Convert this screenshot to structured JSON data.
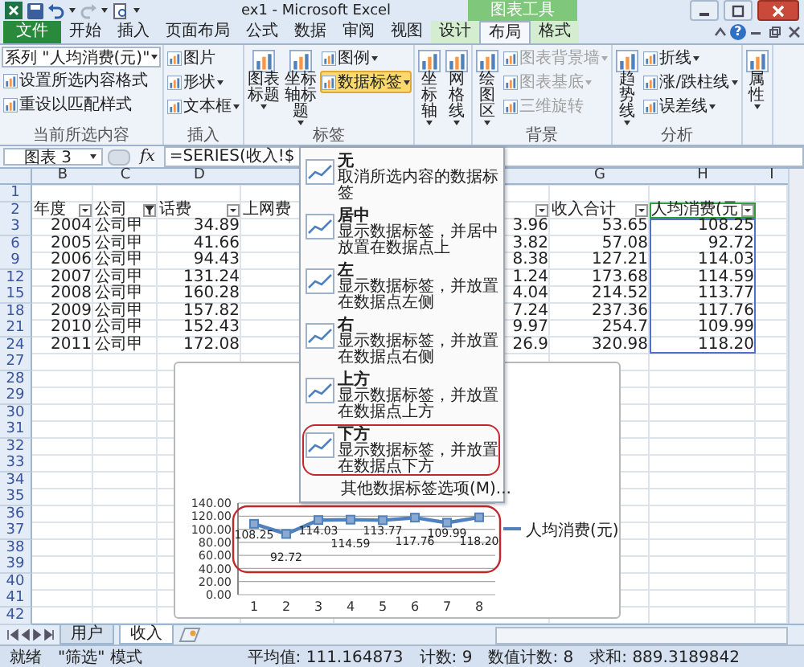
{
  "title_bar": {
    "title": "ex1 - Microsoft Excel",
    "context_label": "图表工具"
  },
  "tabs": [
    {
      "label": "文件",
      "kind": "file",
      "selected": false
    },
    {
      "label": "开始",
      "kind": "normal",
      "selected": false
    },
    {
      "label": "插入",
      "kind": "normal",
      "selected": false
    },
    {
      "label": "页面布局",
      "kind": "normal",
      "selected": false
    },
    {
      "label": "公式",
      "kind": "normal",
      "selected": false
    },
    {
      "label": "数据",
      "kind": "normal",
      "selected": false
    },
    {
      "label": "审阅",
      "kind": "normal",
      "selected": false
    },
    {
      "label": "视图",
      "kind": "normal",
      "selected": false
    },
    {
      "label": "设计",
      "kind": "context",
      "selected": false
    },
    {
      "label": "布局",
      "kind": "context",
      "selected": true
    },
    {
      "label": "格式",
      "kind": "context",
      "selected": false
    }
  ],
  "help": "?",
  "ribbon": {
    "groups": [
      {
        "label": "当前所选内容",
        "buttons": [
          {
            "kind": "select",
            "label": "系列 \"人均消费(元)\""
          },
          {
            "kind": "small",
            "label": "设置所选内容格式",
            "dropdown": false,
            "disabled": false,
            "pressed": false
          },
          {
            "kind": "small",
            "label": "重设以匹配样式",
            "dropdown": false,
            "disabled": false,
            "pressed": false
          }
        ]
      },
      {
        "label": "插入",
        "buttons": [
          {
            "kind": "small",
            "label": "图片",
            "dropdown": false,
            "disabled": false,
            "pressed": false
          },
          {
            "kind": "small",
            "label": "形状",
            "dropdown": true,
            "disabled": false,
            "pressed": false
          },
          {
            "kind": "small",
            "label": "文本框",
            "dropdown": true,
            "disabled": false,
            "pressed": false
          }
        ]
      },
      {
        "label": "标签",
        "buttons": [
          {
            "kind": "large",
            "label": "图表标题",
            "dropdown": true,
            "disabled": false,
            "pressed": false
          },
          {
            "kind": "large",
            "label": "坐标轴标题",
            "dropdown": true,
            "disabled": false,
            "pressed": false
          },
          {
            "kind": "small",
            "label": "图例",
            "dropdown": true,
            "disabled": false,
            "pressed": false
          },
          {
            "kind": "small",
            "label": "数据标签",
            "dropdown": true,
            "disabled": false,
            "pressed": true
          }
        ]
      },
      {
        "buttons": [
          {
            "kind": "large",
            "label": "坐标轴",
            "dropdown": true,
            "disabled": false,
            "pressed": false
          },
          {
            "kind": "large",
            "label": "网格线",
            "dropdown": true,
            "disabled": false,
            "pressed": false
          }
        ]
      },
      {
        "label": "背景",
        "buttons": [
          {
            "kind": "large",
            "label": "绘图区",
            "dropdown": true,
            "disabled": false,
            "pressed": false
          },
          {
            "kind": "small",
            "label": "图表背景墙",
            "dropdown": true,
            "disabled": true,
            "pressed": false
          },
          {
            "kind": "small",
            "label": "图表基底",
            "dropdown": true,
            "disabled": true,
            "pressed": false
          },
          {
            "kind": "small",
            "label": "三维旋转",
            "dropdown": false,
            "disabled": true,
            "pressed": false
          }
        ]
      },
      {
        "label": "分析",
        "buttons": [
          {
            "kind": "large",
            "label": "趋势线",
            "dropdown": true,
            "disabled": false,
            "pressed": false
          },
          {
            "kind": "small",
            "label": "折线",
            "dropdown": true,
            "disabled": false,
            "pressed": false
          },
          {
            "kind": "small",
            "label": "涨/跌柱线",
            "dropdown": true,
            "disabled": false,
            "pressed": false
          },
          {
            "kind": "small",
            "label": "误差线",
            "dropdown": true,
            "disabled": false,
            "pressed": false
          }
        ]
      },
      {
        "buttons": [
          {
            "kind": "large",
            "label": "属性",
            "dropdown": true,
            "disabled": false,
            "pressed": false
          }
        ]
      }
    ]
  },
  "formula_bar": {
    "name_box": "图表 3",
    "fx": "fx",
    "formula": "=SERIES(收入!$"
  },
  "sheet": {
    "columns": [
      "B",
      "C",
      "D",
      null,
      null,
      "G",
      "H",
      "I"
    ],
    "rows": [
      {
        "number": "1",
        "kind": "blank"
      },
      {
        "number": "2",
        "kind": "header",
        "cells": [
          {
            "text": "年度",
            "kind": "filter",
            "source": false
          },
          {
            "text": "公司",
            "kind": "filtered",
            "source": false
          },
          {
            "text": "话费",
            "kind": "filter",
            "source": false
          },
          {
            "text": "上网费",
            "kind": "plain",
            "source": false
          },
          {
            "kind": "filter",
            "source": false
          },
          {
            "text": "收入合计",
            "kind": "filter",
            "source": false
          },
          {
            "text": "人均消费(元",
            "kind": "filter",
            "source": true
          }
        ]
      },
      {
        "number": "3",
        "kind": "data",
        "cells": [
          "2004",
          "公司甲",
          "34.89",
          null,
          "3.96",
          "53.65",
          "108.25"
        ]
      },
      {
        "number": "6",
        "kind": "data",
        "cells": [
          "2005",
          "公司甲",
          "41.66",
          null,
          "3.82",
          "57.08",
          "92.72"
        ]
      },
      {
        "number": "9",
        "kind": "data",
        "cells": [
          "2006",
          "公司甲",
          "94.43",
          null,
          "8.38",
          "127.21",
          "114.03"
        ]
      },
      {
        "number": "12",
        "kind": "data",
        "cells": [
          "2007",
          "公司甲",
          "131.24",
          null,
          "1.24",
          "173.68",
          "114.59"
        ]
      },
      {
        "number": "15",
        "kind": "data",
        "cells": [
          "2008",
          "公司甲",
          "160.28",
          null,
          "4.04",
          "214.52",
          "113.77"
        ]
      },
      {
        "number": "18",
        "kind": "data",
        "cells": [
          "2009",
          "公司甲",
          "157.82",
          null,
          "7.24",
          "237.36",
          "117.76"
        ]
      },
      {
        "number": "21",
        "kind": "data",
        "cells": [
          "2010",
          "公司甲",
          "152.43",
          null,
          "9.97",
          "254.7",
          "109.99"
        ]
      },
      {
        "number": "24",
        "kind": "data",
        "cells": [
          "2011",
          "公司甲",
          "172.08",
          null,
          "26.9",
          "320.98",
          "118.20"
        ]
      },
      {
        "number": "27",
        "kind": "blank"
      },
      {
        "number": "28",
        "kind": "blank"
      },
      {
        "number": "29",
        "kind": "blank"
      },
      {
        "number": "30",
        "kind": "blank"
      },
      {
        "number": "31",
        "kind": "blank"
      },
      {
        "number": "32",
        "kind": "blank"
      },
      {
        "number": "33",
        "kind": "blank"
      },
      {
        "number": "34",
        "kind": "blank"
      },
      {
        "number": "35",
        "kind": "blank"
      },
      {
        "number": "36",
        "kind": "blank"
      },
      {
        "number": "37",
        "kind": "blank"
      },
      {
        "number": "38",
        "kind": "blank"
      },
      {
        "number": "39",
        "kind": "blank"
      },
      {
        "number": "40",
        "kind": "blank"
      },
      {
        "number": "41",
        "kind": "blank"
      },
      {
        "number": "42",
        "kind": "blank"
      }
    ]
  },
  "chart": {
    "chart_data": {
      "type": "line",
      "categories": [
        "1",
        "2",
        "3",
        "4",
        "5",
        "6",
        "7",
        "8"
      ],
      "series": [
        {
          "name": "人均消费(元)",
          "color": "#4f81bd",
          "marker": "square",
          "values": [
            108.25,
            92.72,
            114.03,
            114.59,
            113.77,
            117.76,
            109.99,
            118.2
          ]
        }
      ],
      "ylim": [
        0,
        140
      ],
      "yticks": [
        {
          "value": 0,
          "label": "0.00"
        },
        {
          "value": 20,
          "label": "20.00"
        },
        {
          "value": 40,
          "label": "40.00"
        },
        {
          "value": 60,
          "label": "60.00"
        },
        {
          "value": 80,
          "label": "80.00"
        },
        {
          "value": 100,
          "label": "100.00"
        },
        {
          "value": 120,
          "label": "120.00"
        },
        {
          "value": 140,
          "label": "140.00"
        }
      ],
      "grid": true,
      "value_labels": [
        "108.25",
        "92.72",
        "114.03",
        "114.59",
        "113.77",
        "117.76",
        "109.99",
        "118.20"
      ]
    }
  },
  "menu": {
    "items": [
      {
        "title": "无",
        "description": "取消所选内容的数据标签",
        "circled": false
      },
      {
        "title": "居中",
        "description": "显示数据标签，并居中放置在数据点上",
        "circled": false
      },
      {
        "title": "左",
        "description": "显示数据标签，并放置在数据点左侧",
        "circled": false
      },
      {
        "title": "右",
        "description": "显示数据标签，并放置在数据点右侧",
        "circled": false
      },
      {
        "title": "上方",
        "description": "显示数据标签，并放置在数据点上方",
        "circled": false
      },
      {
        "title": "下方",
        "description": "显示数据标签，并放置在数据点下方",
        "circled": true
      }
    ],
    "footer": "其他数据标签选项(M)..."
  },
  "sheet_tabs": [
    {
      "label": "用户",
      "selected": false
    },
    {
      "label": "收入",
      "selected": true
    }
  ],
  "status_bar": {
    "items": [
      "就绪",
      "\"筛选\" 模式"
    ],
    "stats": [
      "平均值: 111.164873",
      "计数: 9",
      "数值计数: 8",
      "求和: 889.3189842"
    ]
  }
}
